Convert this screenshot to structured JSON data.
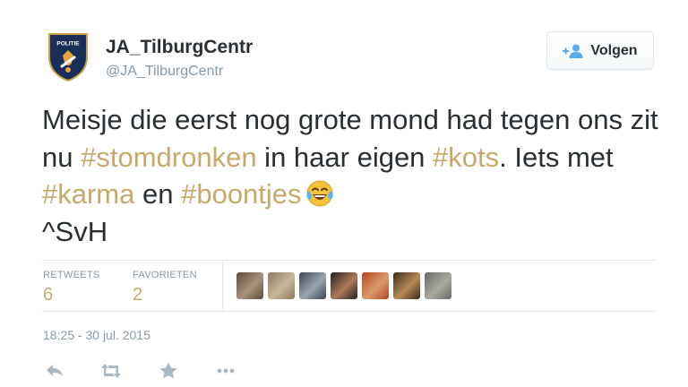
{
  "author": {
    "name": "JA_TilburgCentr",
    "handle": "@JA_TilburgCentr",
    "avatar_text": "POLITIE"
  },
  "follow_button": {
    "label": "Volgen",
    "icon": "add-user-icon"
  },
  "tweet": {
    "segments": [
      {
        "text": "Meisje die eerst nog grote mond had tegen ons zit nu ",
        "type": "text"
      },
      {
        "text": "#stomdronken",
        "type": "hashtag"
      },
      {
        "text": " in haar eigen ",
        "type": "text"
      },
      {
        "text": "#kots",
        "type": "hashtag"
      },
      {
        "text": ". Iets met ",
        "type": "text"
      },
      {
        "text": "#karma",
        "type": "hashtag"
      },
      {
        "text": " en ",
        "type": "text"
      },
      {
        "text": "#boontjes",
        "type": "hashtag"
      },
      {
        "text": "^SvH",
        "type": "text"
      }
    ],
    "emoji": "face-with-tears-of-joy"
  },
  "stats": {
    "retweets_label": "RETWEETS",
    "retweets_value": "6",
    "favorites_label": "FAVORIETEN",
    "favorites_value": "2"
  },
  "favoriter_avatars": [
    {
      "name": "favoriter-1",
      "colors": [
        "#5b4a3f",
        "#a8937a"
      ]
    },
    {
      "name": "favoriter-2",
      "colors": [
        "#8c7a5e",
        "#c9b79a"
      ]
    },
    {
      "name": "favoriter-3",
      "colors": [
        "#3d4755",
        "#9aa3ad"
      ]
    },
    {
      "name": "favoriter-4",
      "colors": [
        "#1f1f1f",
        "#b07a5a"
      ]
    },
    {
      "name": "favoriter-5",
      "colors": [
        "#b5461d",
        "#d99a6b"
      ]
    },
    {
      "name": "favoriter-6",
      "colors": [
        "#3a2b22",
        "#b58a52"
      ]
    },
    {
      "name": "favoriter-7",
      "colors": [
        "#6a6a66",
        "#a9a89f"
      ]
    }
  ],
  "timestamp": "18:25 - 30 jul. 2015",
  "actions": [
    {
      "name": "reply-icon"
    },
    {
      "name": "retweet-icon"
    },
    {
      "name": "favorite-star-icon"
    },
    {
      "name": "more-dots-icon"
    }
  ],
  "colors": {
    "accent": "#c8a96a",
    "text": "#292f33",
    "muted": "#8899a6",
    "border": "#e1e8ed",
    "follow_icon": "#55acee"
  }
}
